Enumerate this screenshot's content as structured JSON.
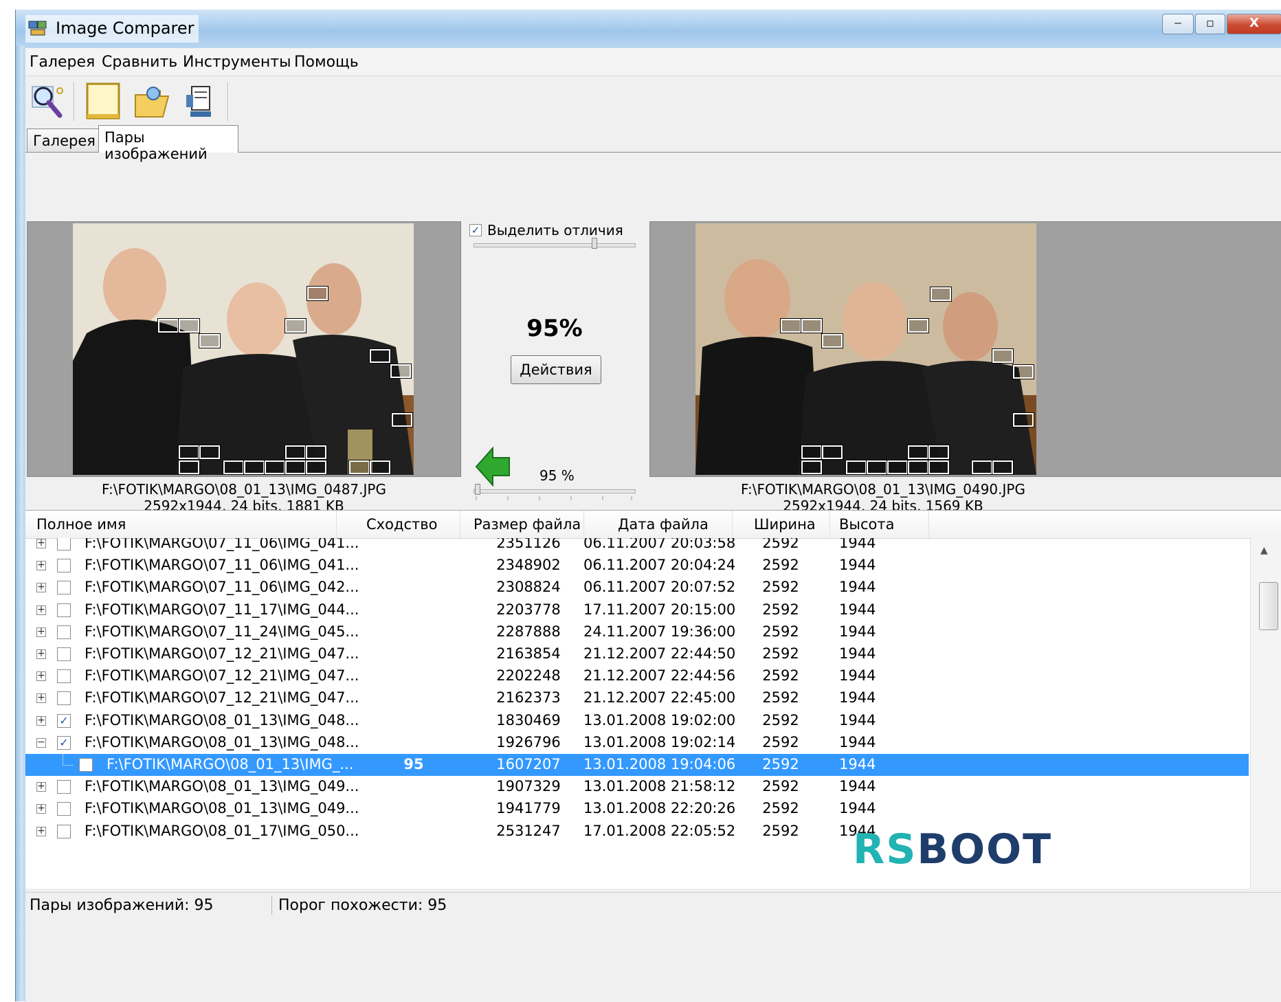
{
  "window": {
    "title": "Image Comparer"
  },
  "caption_buttons": {
    "minimize": "‒",
    "maximize": "▫",
    "close": "X"
  },
  "menu": [
    "Галерея",
    "Сравнить",
    "Инструменты",
    "Помощь"
  ],
  "toolbar": [
    {
      "icon": "search-icon"
    },
    {
      "icon": "blank-page-icon"
    },
    {
      "icon": "open-folder-icon"
    },
    {
      "icon": "compress-icon"
    }
  ],
  "tabs": [
    {
      "label": "Галерея",
      "active": false
    },
    {
      "label": "Пары изображений",
      "active": true
    }
  ],
  "compare": {
    "highlight_label": "Выделить отличия",
    "highlight_checked": true,
    "similarity": "95%",
    "actions_label": "Действия",
    "threshold_label": "95 %",
    "left": {
      "path": "F:\\FOTIK\\MARGO\\08_01_13\\IMG_0487.JPG",
      "info": "2592x1944, 24 bits, 1881 KB"
    },
    "right": {
      "path": "F:\\FOTIK\\MARGO\\08_01_13\\IMG_0490.JPG",
      "info": "2592x1944, 24 bits, 1569 KB"
    }
  },
  "list": {
    "columns": [
      "Полное имя",
      "Сходство",
      "Размер файла",
      "Дата файла",
      "Ширина",
      "Высота"
    ],
    "rows": [
      {
        "name": "F:\\FOTIK\\MARGO\\07_11_06\\IMG_041...",
        "sim": "",
        "size": "2351126",
        "date": "06.11.2007 20:03:58",
        "w": "2592",
        "h": "1944",
        "checked": false,
        "exp": "+",
        "sel": false,
        "child": false
      },
      {
        "name": "F:\\FOTIK\\MARGO\\07_11_06\\IMG_041...",
        "sim": "",
        "size": "2348902",
        "date": "06.11.2007 20:04:24",
        "w": "2592",
        "h": "1944",
        "checked": false,
        "exp": "+",
        "sel": false,
        "child": false
      },
      {
        "name": "F:\\FOTIK\\MARGO\\07_11_06\\IMG_042...",
        "sim": "",
        "size": "2308824",
        "date": "06.11.2007 20:07:52",
        "w": "2592",
        "h": "1944",
        "checked": false,
        "exp": "+",
        "sel": false,
        "child": false
      },
      {
        "name": "F:\\FOTIK\\MARGO\\07_11_17\\IMG_044...",
        "sim": "",
        "size": "2203778",
        "date": "17.11.2007 20:15:00",
        "w": "2592",
        "h": "1944",
        "checked": false,
        "exp": "+",
        "sel": false,
        "child": false
      },
      {
        "name": "F:\\FOTIK\\MARGO\\07_11_24\\IMG_045...",
        "sim": "",
        "size": "2287888",
        "date": "24.11.2007 19:36:00",
        "w": "2592",
        "h": "1944",
        "checked": false,
        "exp": "+",
        "sel": false,
        "child": false
      },
      {
        "name": "F:\\FOTIK\\MARGO\\07_12_21\\IMG_047...",
        "sim": "",
        "size": "2163854",
        "date": "21.12.2007 22:44:50",
        "w": "2592",
        "h": "1944",
        "checked": false,
        "exp": "+",
        "sel": false,
        "child": false
      },
      {
        "name": "F:\\FOTIK\\MARGO\\07_12_21\\IMG_047...",
        "sim": "",
        "size": "2202248",
        "date": "21.12.2007 22:44:56",
        "w": "2592",
        "h": "1944",
        "checked": false,
        "exp": "+",
        "sel": false,
        "child": false
      },
      {
        "name": "F:\\FOTIK\\MARGO\\07_12_21\\IMG_047...",
        "sim": "",
        "size": "2162373",
        "date": "21.12.2007 22:45:00",
        "w": "2592",
        "h": "1944",
        "checked": false,
        "exp": "+",
        "sel": false,
        "child": false
      },
      {
        "name": "F:\\FOTIK\\MARGO\\08_01_13\\IMG_048...",
        "sim": "",
        "size": "1830469",
        "date": "13.01.2008 19:02:00",
        "w": "2592",
        "h": "1944",
        "checked": true,
        "exp": "+",
        "sel": false,
        "child": false
      },
      {
        "name": "F:\\FOTIK\\MARGO\\08_01_13\\IMG_048...",
        "sim": "",
        "size": "1926796",
        "date": "13.01.2008 19:02:14",
        "w": "2592",
        "h": "1944",
        "checked": true,
        "exp": "−",
        "sel": false,
        "child": false
      },
      {
        "name": "F:\\FOTIK\\MARGO\\08_01_13\\IMG_...",
        "sim": "95",
        "size": "1607207",
        "date": "13.01.2008 19:04:06",
        "w": "2592",
        "h": "1944",
        "checked": false,
        "exp": "",
        "sel": true,
        "child": true
      },
      {
        "name": "F:\\FOTIK\\MARGO\\08_01_13\\IMG_049...",
        "sim": "",
        "size": "1907329",
        "date": "13.01.2008 21:58:12",
        "w": "2592",
        "h": "1944",
        "checked": false,
        "exp": "+",
        "sel": false,
        "child": false
      },
      {
        "name": "F:\\FOTIK\\MARGO\\08_01_13\\IMG_049...",
        "sim": "",
        "size": "1941779",
        "date": "13.01.2008 22:20:26",
        "w": "2592",
        "h": "1944",
        "checked": false,
        "exp": "+",
        "sel": false,
        "child": false
      },
      {
        "name": "F:\\FOTIK\\MARGO\\08_01_17\\IMG_050...",
        "sim": "",
        "size": "2531247",
        "date": "17.01.2008 22:05:52",
        "w": "2592",
        "h": "1944",
        "checked": false,
        "exp": "+",
        "sel": false,
        "child": false
      }
    ]
  },
  "status": {
    "pairs": "Пары изображений: 95",
    "threshold": "Порог похожести: 95"
  },
  "watermark": {
    "text_rs": "RS",
    "text_boot": "BOOT",
    "color_rs": "#22b3b3",
    "color_boot": "#1f3d6b"
  },
  "colors": {
    "selection": "#3399ff",
    "arrow": "#2fa82f"
  }
}
